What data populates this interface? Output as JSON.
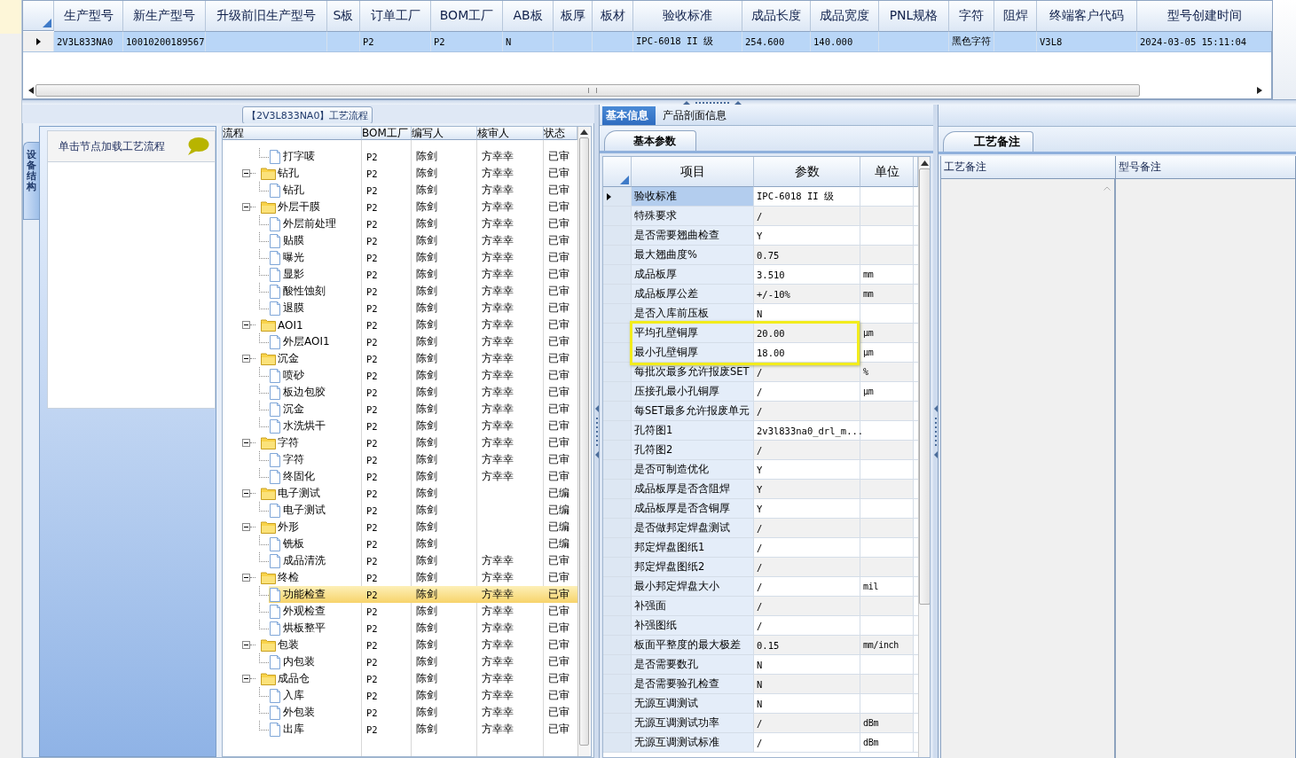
{
  "top_grid": {
    "columns": [
      "生产型号",
      "新生产型号",
      "升级前旧生产型号",
      "S板",
      "订单工厂",
      "BOM工厂",
      "AB板",
      "板厚",
      "板材",
      "验收标准",
      "成品长度",
      "成品宽度",
      "PNL规格",
      "字符",
      "阻焊",
      "终端客户代码",
      "型号创建时间"
    ],
    "rows": [
      {
        "selected": true,
        "cells": [
          "2V3L833NA0",
          "10010200189567",
          null,
          null,
          "P2",
          "P2",
          "N",
          null,
          null,
          "IPC-6018 II 级",
          "254.600",
          "140.000",
          null,
          "黑色字符",
          null,
          "V3L8",
          "2024-03-05 15:11:04"
        ]
      }
    ]
  },
  "flow": {
    "title": "【2V3L833NA0】工艺流程",
    "side_tab": "设备结构",
    "hint": "单击节点加载工艺流程",
    "columns": [
      "流程",
      "BOM工厂",
      "编写人",
      "核审人",
      "状态"
    ],
    "nodes": [
      {
        "label": "打字唛",
        "kind": "step",
        "selected": false,
        "bom": "P2",
        "writer": "陈剑",
        "reviewer": "方幸幸",
        "status": "已审"
      },
      {
        "label": "钻孔",
        "kind": "folder",
        "expanded": true,
        "selected": false,
        "bom": "P2",
        "writer": "陈剑",
        "reviewer": "方幸幸",
        "status": "已审",
        "children": [
          {
            "label": "钻孔",
            "kind": "step",
            "selected": false,
            "bom": "P2",
            "writer": "陈剑",
            "reviewer": "方幸幸",
            "status": "已审"
          }
        ]
      },
      {
        "label": "外层干膜",
        "kind": "folder",
        "expanded": true,
        "selected": false,
        "bom": "P2",
        "writer": "陈剑",
        "reviewer": "方幸幸",
        "status": "已审",
        "children": [
          {
            "label": "外层前处理",
            "kind": "step",
            "selected": false,
            "bom": "P2",
            "writer": "陈剑",
            "reviewer": "方幸幸",
            "status": "已审"
          },
          {
            "label": "贴膜",
            "kind": "step",
            "selected": false,
            "bom": "P2",
            "writer": "陈剑",
            "reviewer": "方幸幸",
            "status": "已审"
          },
          {
            "label": "曝光",
            "kind": "step",
            "selected": false,
            "bom": "P2",
            "writer": "陈剑",
            "reviewer": "方幸幸",
            "status": "已审"
          },
          {
            "label": "显影",
            "kind": "step",
            "selected": false,
            "bom": "P2",
            "writer": "陈剑",
            "reviewer": "方幸幸",
            "status": "已审"
          },
          {
            "label": "酸性蚀刻",
            "kind": "step",
            "selected": false,
            "bom": "P2",
            "writer": "陈剑",
            "reviewer": "方幸幸",
            "status": "已审"
          },
          {
            "label": "退膜",
            "kind": "step",
            "selected": false,
            "bom": "P2",
            "writer": "陈剑",
            "reviewer": "方幸幸",
            "status": "已审"
          }
        ]
      },
      {
        "label": "AOI1",
        "kind": "folder",
        "expanded": true,
        "selected": false,
        "bom": "P2",
        "writer": "陈剑",
        "reviewer": "方幸幸",
        "status": "已审",
        "children": [
          {
            "label": "外层AOI1",
            "kind": "step",
            "selected": false,
            "bom": "P2",
            "writer": "陈剑",
            "reviewer": "方幸幸",
            "status": "已审"
          }
        ]
      },
      {
        "label": "沉金",
        "kind": "folder",
        "expanded": true,
        "selected": false,
        "bom": "P2",
        "writer": "陈剑",
        "reviewer": "方幸幸",
        "status": "已审",
        "children": [
          {
            "label": "喷砂",
            "kind": "step",
            "selected": false,
            "bom": "P2",
            "writer": "陈剑",
            "reviewer": "方幸幸",
            "status": "已审"
          },
          {
            "label": "板边包胶",
            "kind": "step",
            "selected": false,
            "bom": "P2",
            "writer": "陈剑",
            "reviewer": "方幸幸",
            "status": "已审"
          },
          {
            "label": "沉金",
            "kind": "step",
            "selected": false,
            "bom": "P2",
            "writer": "陈剑",
            "reviewer": "方幸幸",
            "status": "已审"
          },
          {
            "label": "水洗烘干",
            "kind": "step",
            "selected": false,
            "bom": "P2",
            "writer": "陈剑",
            "reviewer": "方幸幸",
            "status": "已审"
          }
        ]
      },
      {
        "label": "字符",
        "kind": "folder",
        "expanded": true,
        "selected": false,
        "bom": "P2",
        "writer": "陈剑",
        "reviewer": "方幸幸",
        "status": "已审",
        "children": [
          {
            "label": "字符",
            "kind": "step",
            "selected": false,
            "bom": "P2",
            "writer": "陈剑",
            "reviewer": "方幸幸",
            "status": "已审"
          },
          {
            "label": "终固化",
            "kind": "step",
            "selected": false,
            "bom": "P2",
            "writer": "陈剑",
            "reviewer": "方幸幸",
            "status": "已审"
          }
        ]
      },
      {
        "label": "电子测试",
        "kind": "folder",
        "expanded": true,
        "selected": false,
        "bom": "P2",
        "writer": "陈剑",
        "status": "已编",
        "children": [
          {
            "label": "电子测试",
            "kind": "step",
            "selected": false,
            "bom": "P2",
            "writer": "陈剑",
            "status": "已编"
          }
        ]
      },
      {
        "label": "外形",
        "kind": "folder",
        "expanded": true,
        "selected": false,
        "bom": "P2",
        "writer": "陈剑",
        "status": "已编",
        "children": [
          {
            "label": "铣板",
            "kind": "step",
            "selected": false,
            "bom": "P2",
            "writer": "陈剑",
            "status": "已编"
          },
          {
            "label": "成品清洗",
            "kind": "step",
            "selected": false,
            "bom": "P2",
            "writer": "陈剑",
            "reviewer": "方幸幸",
            "status": "已审"
          }
        ]
      },
      {
        "label": "终检",
        "kind": "folder",
        "expanded": true,
        "selected": false,
        "bom": "P2",
        "writer": "陈剑",
        "reviewer": "方幸幸",
        "status": "已审",
        "children": [
          {
            "label": "功能检查",
            "kind": "step",
            "selected": true,
            "bom": "P2",
            "writer": "陈剑",
            "reviewer": "方幸幸",
            "status": "已审"
          },
          {
            "label": "外观检查",
            "kind": "step",
            "selected": false,
            "bom": "P2",
            "writer": "陈剑",
            "reviewer": "方幸幸",
            "status": "已审"
          },
          {
            "label": "烘板整平",
            "kind": "step",
            "selected": false,
            "bom": "P2",
            "writer": "陈剑",
            "reviewer": "方幸幸",
            "status": "已审"
          }
        ]
      },
      {
        "label": "包装",
        "kind": "folder",
        "expanded": true,
        "selected": false,
        "bom": "P2",
        "writer": "陈剑",
        "reviewer": "方幸幸",
        "status": "已审",
        "children": [
          {
            "label": "内包装",
            "kind": "step",
            "selected": false,
            "bom": "P2",
            "writer": "陈剑",
            "reviewer": "方幸幸",
            "status": "已审"
          }
        ]
      },
      {
        "label": "成品仓",
        "kind": "folder",
        "expanded": true,
        "selected": false,
        "bom": "P2",
        "writer": "陈剑",
        "reviewer": "方幸幸",
        "status": "已审",
        "children": [
          {
            "label": "入库",
            "kind": "step",
            "selected": false,
            "bom": "P2",
            "writer": "陈剑",
            "reviewer": "方幸幸",
            "status": "已审"
          },
          {
            "label": "外包装",
            "kind": "step",
            "selected": false,
            "bom": "P2",
            "writer": "陈剑",
            "reviewer": "方幸幸",
            "status": "已审"
          },
          {
            "label": "出库",
            "kind": "step",
            "selected": false,
            "bom": "P2",
            "writer": "陈剑",
            "reviewer": "方幸幸",
            "status": "已审"
          }
        ]
      }
    ]
  },
  "params": {
    "tabs": [
      {
        "label": "基本信息",
        "selected": true
      },
      {
        "label": "产品剖面信息",
        "selected": false
      }
    ],
    "subtab": "基本参数",
    "columns": [
      "项目",
      "参数",
      "单位"
    ],
    "rows": [
      {
        "item": "验收标准",
        "value": "IPC-6018 II 级",
        "selected": true,
        "highlighted": false
      },
      {
        "item": "特殊要求",
        "value": "/",
        "selected": false,
        "highlighted": false
      },
      {
        "item": "是否需要翘曲检查",
        "value": "Y",
        "selected": false,
        "highlighted": false
      },
      {
        "item": "最大翘曲度%",
        "value": "0.75",
        "selected": false,
        "highlighted": false
      },
      {
        "item": "成品板厚",
        "value": "3.510",
        "unit": "mm",
        "selected": false,
        "highlighted": false
      },
      {
        "item": "成品板厚公差",
        "value": "+/-10%",
        "unit": "mm",
        "selected": false,
        "highlighted": false
      },
      {
        "item": "是否入库前压板",
        "value": "N",
        "selected": false,
        "highlighted": false
      },
      {
        "item": "平均孔壁铜厚",
        "value": "20.00",
        "unit": "μm",
        "selected": false,
        "highlighted": true
      },
      {
        "item": "最小孔壁铜厚",
        "value": "18.00",
        "unit": "μm",
        "selected": false,
        "highlighted": true
      },
      {
        "item": "每批次最多允许报废SET",
        "value": "/",
        "unit": "%",
        "selected": false,
        "highlighted": false
      },
      {
        "item": "压接孔最小孔铜厚",
        "value": "/",
        "unit": "μm",
        "selected": false,
        "highlighted": false
      },
      {
        "item": "每SET最多允许报废单元",
        "value": "/",
        "selected": false,
        "highlighted": false
      },
      {
        "item": "孔符图1",
        "value": "2v3l833na0_drl_m...",
        "selected": false,
        "highlighted": false
      },
      {
        "item": "孔符图2",
        "value": "/",
        "selected": false,
        "highlighted": false
      },
      {
        "item": "是否可制造优化",
        "value": "Y",
        "selected": false,
        "highlighted": false
      },
      {
        "item": "成品板厚是否含阻焊",
        "value": "Y",
        "selected": false,
        "highlighted": false
      },
      {
        "item": "成品板厚是否含铜厚",
        "value": "Y",
        "selected": false,
        "highlighted": false
      },
      {
        "item": "是否做邦定焊盘测试",
        "value": "/",
        "selected": false,
        "highlighted": false
      },
      {
        "item": "邦定焊盘图纸1",
        "value": "/",
        "selected": false,
        "highlighted": false
      },
      {
        "item": "邦定焊盘图纸2",
        "value": "/",
        "selected": false,
        "highlighted": false
      },
      {
        "item": "最小邦定焊盘大小",
        "value": "/",
        "unit": "mil",
        "selected": false,
        "highlighted": false
      },
      {
        "item": "补强面",
        "value": "/",
        "selected": false,
        "highlighted": false
      },
      {
        "item": "补强图纸",
        "value": "/",
        "selected": false,
        "highlighted": false
      },
      {
        "item": "板面平整度的最大极差",
        "value": "0.15",
        "unit": "mm/inch",
        "selected": false,
        "highlighted": false
      },
      {
        "item": "是否需要数孔",
        "value": "N",
        "selected": false,
        "highlighted": false
      },
      {
        "item": "是否需要验孔检查",
        "value": "N",
        "selected": false,
        "highlighted": false
      },
      {
        "item": "无源互调测试",
        "value": "N",
        "selected": false,
        "highlighted": false
      },
      {
        "item": "无源互调测试功率",
        "value": "/",
        "unit": "dBm",
        "selected": false,
        "highlighted": false
      },
      {
        "item": "无源互调测试标准",
        "value": "/",
        "unit": "dBm",
        "selected": false,
        "highlighted": false
      }
    ]
  },
  "notes": {
    "subtab": "工艺备注",
    "columns": [
      "工艺备注",
      "型号备注"
    ]
  }
}
